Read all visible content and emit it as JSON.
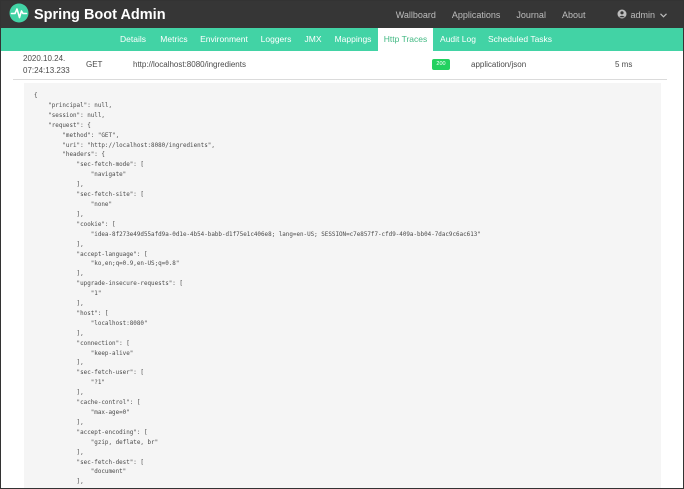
{
  "header": {
    "brand": "Spring Boot Admin",
    "nav": [
      "Wallboard",
      "Applications",
      "Journal",
      "About"
    ],
    "user": "admin"
  },
  "tabs": [
    "Details",
    "Metrics",
    "Environment",
    "Loggers",
    "JMX",
    "Mappings",
    "Http Traces",
    "Audit Log",
    "Scheduled Tasks"
  ],
  "active_tab": "Http Traces",
  "trace": {
    "date": "2020.10.24.",
    "time": "07:24:13.233",
    "method": "GET",
    "uri": "http://localhost:8080/ingredients",
    "status": "200",
    "content_type": "application/json",
    "duration": "5 ms"
  },
  "json_text": "{\n    \"principal\": null,\n    \"session\": null,\n    \"request\": {\n        \"method\": \"GET\",\n        \"uri\": \"http://localhost:8080/ingredients\",\n        \"headers\": {\n            \"sec-fetch-mode\": [\n                \"navigate\"\n            ],\n            \"sec-fetch-site\": [\n                \"none\"\n            ],\n            \"cookie\": [\n                \"idea-8f273e49d55afd9a-0d1e-4b54-babb-d1f75e1c406e8; lang=en-US; SESSION=c7e857f7-cfd9-409a-bb04-7dac9c6ac613\"\n            ],\n            \"accept-language\": [\n                \"ko,en;q=0.9,en-US;q=0.8\"\n            ],\n            \"upgrade-insecure-requests\": [\n                \"1\"\n            ],\n            \"host\": [\n                \"localhost:8080\"\n            ],\n            \"connection\": [\n                \"keep-alive\"\n            ],\n            \"sec-fetch-user\": [\n                \"?1\"\n            ],\n            \"cache-control\": [\n                \"max-age=0\"\n            ],\n            \"accept-encoding\": [\n                \"gzip, deflate, br\"\n            ],\n            \"sec-fetch-dest\": [\n                \"document\"\n            ],\n            \"user-agent\": [",
  "colors": {
    "topbar": "#363636",
    "accent": "#42d3a5",
    "status_ok": "#23d160"
  }
}
